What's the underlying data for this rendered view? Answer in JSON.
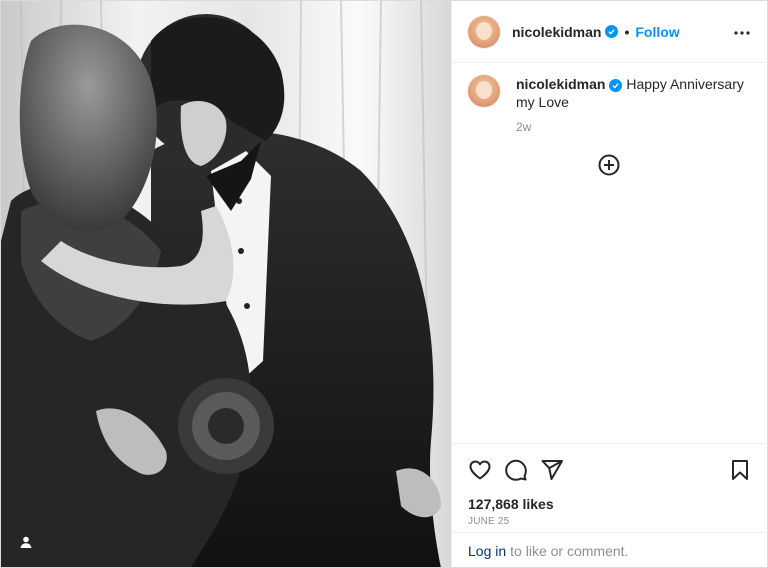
{
  "post": {
    "author": {
      "username": "nicolekidman",
      "verified": true,
      "avatar": "profile-photo"
    },
    "follow_label": "Follow",
    "separator": "•",
    "caption": {
      "username": "nicolekidman",
      "text": "Happy Anniversary my Love",
      "time": "2w"
    },
    "likes": "127,868 likes",
    "date": "JUNE 25",
    "login_link": "Log in",
    "login_text": "to like or comment."
  },
  "icons": {
    "more": "more-options-icon",
    "add_comment": "plus-circle-icon",
    "like": "heart-icon",
    "comment": "comment-icon",
    "share": "paper-plane-icon",
    "save": "bookmark-icon",
    "tag": "user-tag-icon",
    "verified": "verified-badge-icon"
  },
  "colors": {
    "accent": "#0095f6",
    "text": "#262626",
    "muted": "#8e8e8e",
    "link": "#00376b",
    "border": "#dbdbdb"
  }
}
